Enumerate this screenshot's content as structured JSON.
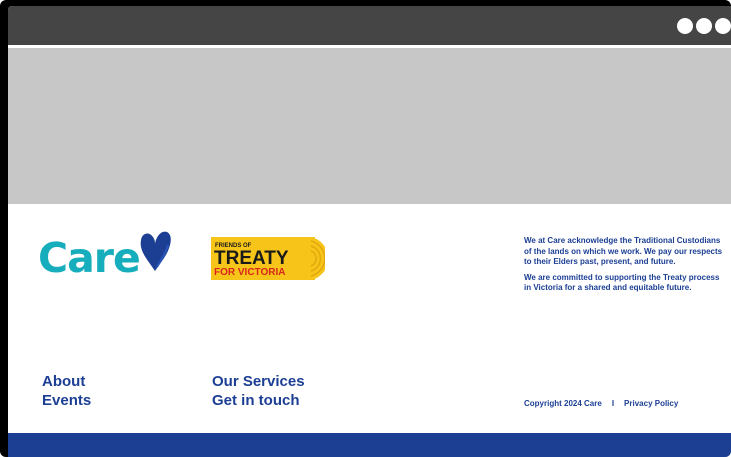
{
  "window": {
    "controls": [
      "dot",
      "dot",
      "dot"
    ]
  },
  "brand": {
    "logo_text": "Care",
    "heart_color": "#1c3f94",
    "logo_color": "#16aebc"
  },
  "partner_logo": {
    "line1": "FRIENDS OF",
    "line2": "TREATY",
    "line3": "FOR VICTORIA"
  },
  "acknowledgement": {
    "paragraph1": "We at Care acknowledge the Traditional Custodians of the lands on which we work. We pay our respects to their Elders past, present, and future.",
    "paragraph2": "We are committed to supporting the Treaty process in Victoria for a shared and equitable future."
  },
  "footer_nav": {
    "col1": [
      "About",
      "Events"
    ],
    "col2": [
      "Our Services",
      "Get in touch"
    ]
  },
  "legal": {
    "copyright": "Copyright 2024 Care",
    "separator": "I",
    "privacy": "Privacy Policy"
  },
  "colors": {
    "primary": "#1c3f94",
    "accent": "#16aebc",
    "titlebar": "#454545",
    "hero_placeholder": "#c7c7c7",
    "treaty_yellow": "#f7c51a",
    "treaty_red": "#d7261e"
  }
}
